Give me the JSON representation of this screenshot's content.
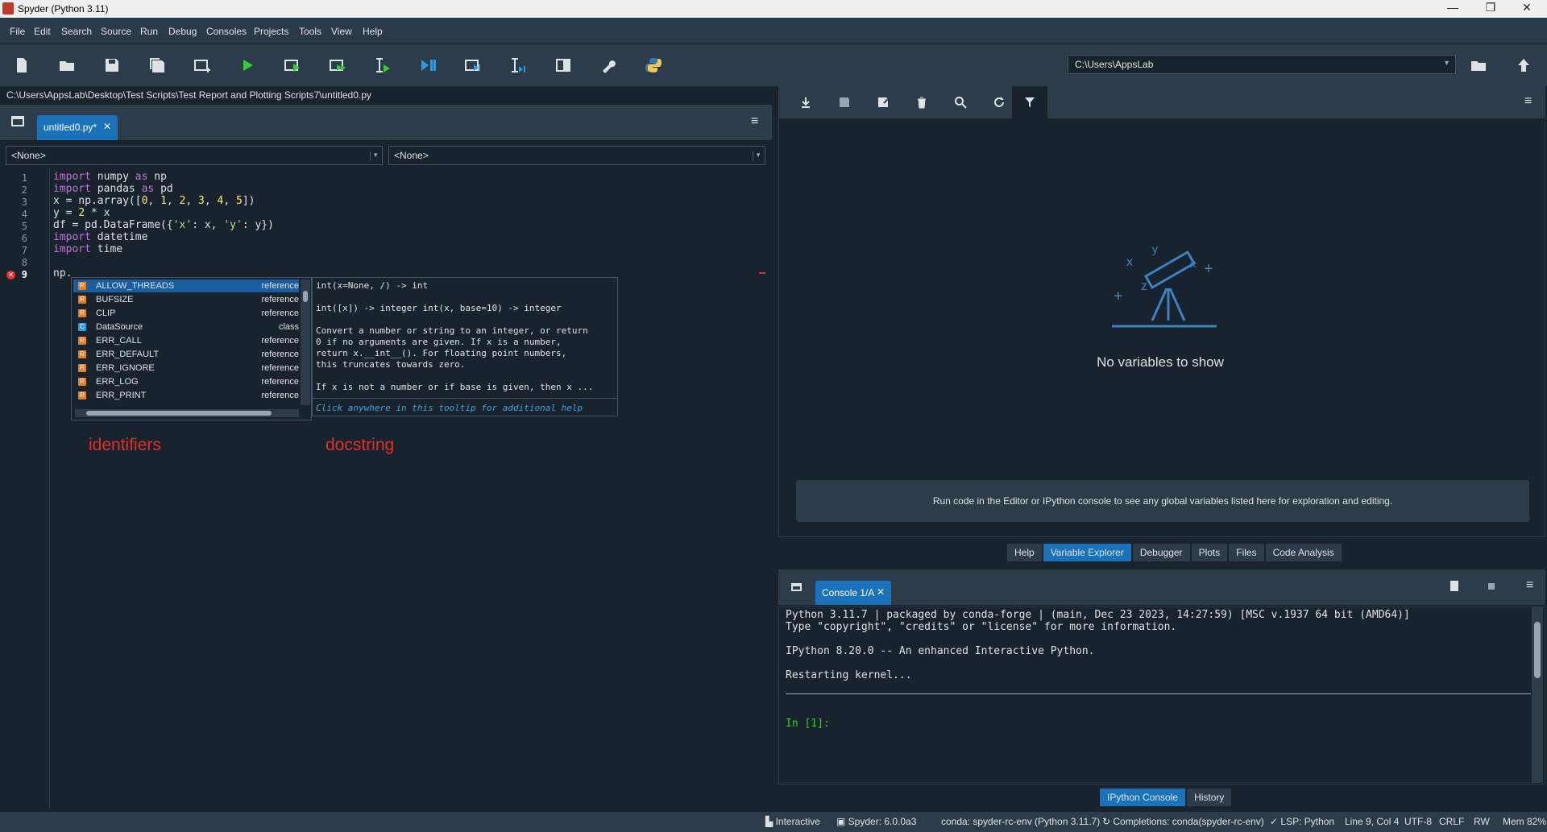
{
  "window": {
    "title": "Spyder (Python 3.11)"
  },
  "menu": [
    "File",
    "Edit",
    "Search",
    "Source",
    "Run",
    "Debug",
    "Consoles",
    "Projects",
    "Tools",
    "View",
    "Help"
  ],
  "toolbar": {
    "icons": [
      "new-file-icon",
      "open-folder-icon",
      "save-icon",
      "save-all-icon",
      "new-cell-icon",
      "run-icon",
      "run-cell-icon",
      "run-cell-advance-icon",
      "run-selection-icon",
      "debug-icon",
      "debug-cell-icon",
      "debug-selection-icon",
      "maximize-pane-icon",
      "wrench-icon",
      "python-icon"
    ],
    "working_dir": "C:\\Users\\AppsLab"
  },
  "editor": {
    "file_path": "C:\\Users\\AppsLab\\Desktop\\Test Scripts\\Test Report and Plotting Scripts7\\untitled0.py",
    "tab_label": "untitled0.py*",
    "class_combo": "<None>",
    "function_combo": "<None>",
    "line_numbers": [
      "1",
      "2",
      "3",
      "4",
      "5",
      "6",
      "7",
      "8",
      "9"
    ],
    "lines": [
      "import numpy as np",
      "import pandas as pd",
      "x = np.array([0, 1, 2, 3, 4, 5])",
      "y = 2 * x",
      "df = pd.DataFrame({'x': x, 'y': y})",
      "import datetime",
      "import time",
      "",
      "np."
    ]
  },
  "completion": {
    "items": [
      {
        "name": "ALLOW_THREADS",
        "type": "reference",
        "kind": "R"
      },
      {
        "name": "BUFSIZE",
        "type": "reference",
        "kind": "R"
      },
      {
        "name": "CLIP",
        "type": "reference",
        "kind": "R"
      },
      {
        "name": "DataSource",
        "type": "class",
        "kind": "C"
      },
      {
        "name": "ERR_CALL",
        "type": "reference",
        "kind": "R"
      },
      {
        "name": "ERR_DEFAULT",
        "type": "reference",
        "kind": "R"
      },
      {
        "name": "ERR_IGNORE",
        "type": "reference",
        "kind": "R"
      },
      {
        "name": "ERR_LOG",
        "type": "reference",
        "kind": "R"
      },
      {
        "name": "ERR_PRINT",
        "type": "reference",
        "kind": "R"
      }
    ],
    "colors": {
      "reference": "#e67e22",
      "class": "#3498db"
    }
  },
  "docstring": {
    "lines": [
      "int(x=None, /) -> int",
      "",
      "int([x]) -> integer int(x, base=10) -> integer",
      "",
      "Convert a number or string to an integer, or return",
      "0 if no arguments are given. If x is a number,",
      "return x.__int__(). For floating point numbers,",
      "this truncates towards zero.",
      "",
      "If x is not a number or if base is given, then x ..."
    ],
    "hint": "Click anywhere in this tooltip for additional help"
  },
  "annotations": {
    "left": "identifiers",
    "right": "docstring"
  },
  "variable_explorer": {
    "empty_title": "No variables to show",
    "hint": "Run code in the Editor or IPython console to see any global variables listed here for exploration and editing.",
    "tabs": [
      "Help",
      "Variable Explorer",
      "Debugger",
      "Plots",
      "Files",
      "Code Analysis"
    ],
    "active_tab": "Variable Explorer"
  },
  "console": {
    "tab_label": "Console 1/A",
    "lines": [
      "Python 3.11.7 | packaged by conda-forge | (main, Dec 23 2023, 14:27:59) [MSC v.1937 64 bit (AMD64)]",
      "Type \"copyright\", \"credits\" or \"license\" for more information.",
      "",
      "IPython 8.20.0 -- An enhanced Interactive Python.",
      "",
      "Restarting kernel..."
    ],
    "prompt": "In [1]:",
    "tabs": [
      "IPython Console",
      "History"
    ],
    "active_tab": "IPython Console"
  },
  "status": {
    "interactive": "Interactive",
    "spyder": "Spyder: 6.0.0a3",
    "conda": "conda: spyder-rc-env (Python 3.11.7)",
    "completions": "Completions: conda(spyder-rc-env)",
    "lsp": "LSP: Python",
    "position": "Line 9, Col 4",
    "encoding": "UTF-8",
    "eol": "CRLF",
    "rw": "RW",
    "mem": "Mem 82%"
  }
}
